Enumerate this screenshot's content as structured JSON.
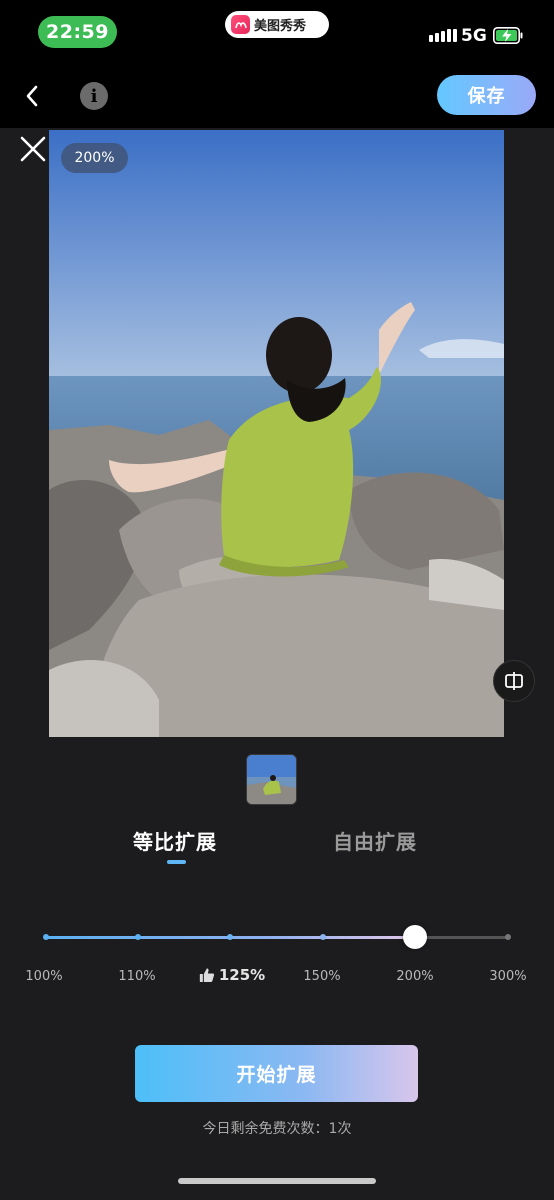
{
  "status_bar": {
    "time": "22:59",
    "app_badge": "美图秀秀",
    "network": "5G",
    "signal_icon": "signal-bars-icon",
    "battery_icon": "battery-charging-icon"
  },
  "toolbar": {
    "back_icon": "chevron-left-icon",
    "info_icon": "info-icon",
    "save_label": "保存"
  },
  "canvas": {
    "close_icon": "close-icon",
    "zoom_badge": "200%",
    "compare_icon": "compare-icon"
  },
  "tabs": [
    {
      "label": "等比扩展",
      "active": true
    },
    {
      "label": "自由扩展",
      "active": false
    }
  ],
  "slider": {
    "stops": [
      "100%",
      "110%",
      "125%",
      "150%",
      "200%",
      "300%"
    ],
    "recommended_stop": "125%",
    "recommended_icon": "thumbs-up-icon",
    "selected_value": "200%"
  },
  "actions": {
    "start_label": "开始扩展",
    "quota_text": "今日剩余免费次数：1次"
  },
  "colors": {
    "accent_blue": "#5bb1f2",
    "status_green": "#3dbb55",
    "panel_bg": "#1c1c1e"
  }
}
